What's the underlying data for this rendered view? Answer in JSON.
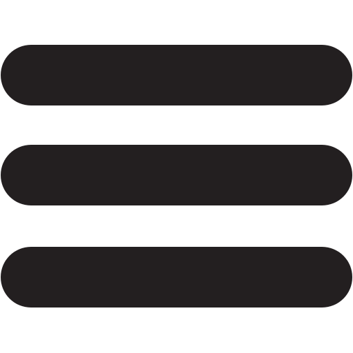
{
  "icon": {
    "name": "hamburger-menu-icon",
    "color": "#231f20",
    "bar_count": 3
  }
}
